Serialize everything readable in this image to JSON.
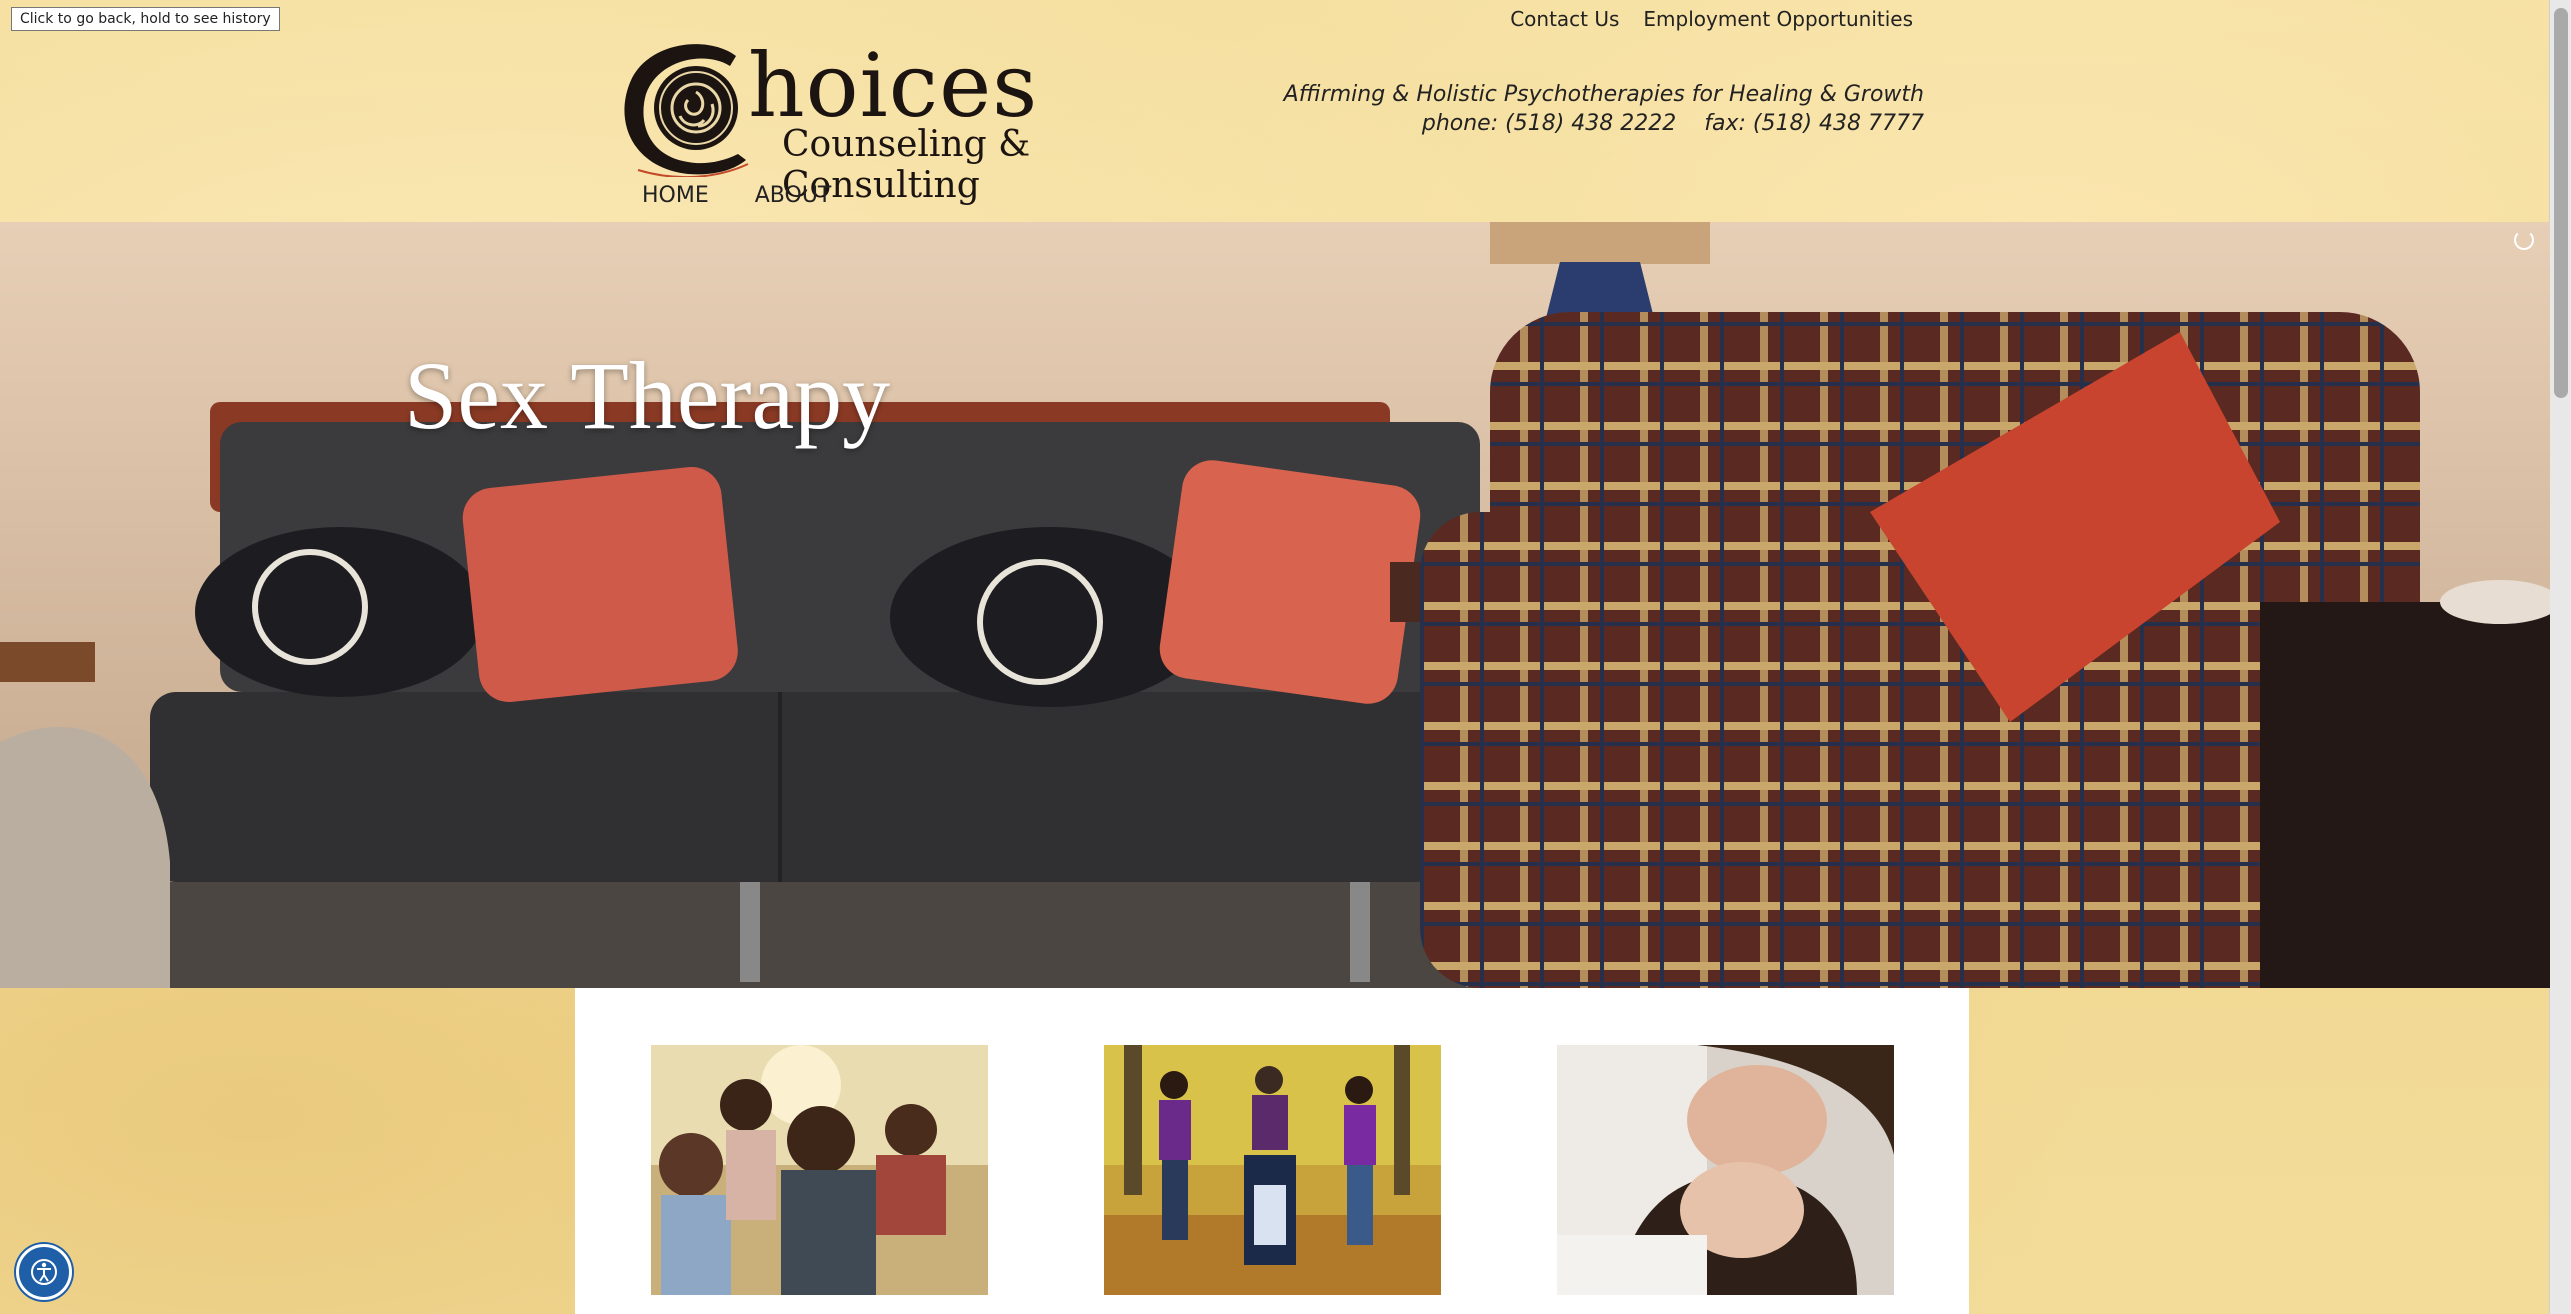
{
  "browser": {
    "back_tooltip": "Click to go back, hold to see history"
  },
  "header": {
    "top_links": [
      "Contact Us",
      "Employment Opportunities"
    ],
    "logo_title": "hoices",
    "logo_initial": "C",
    "logo_subtitle": "Counseling & Consulting",
    "tagline": "Affirming & Holistic Psychotherapies for Healing & Growth",
    "phone_line": "phone: (518) 438 2222    fax: (518) 438 7777",
    "nav": [
      "HOME",
      "ABOUT"
    ]
  },
  "hero": {
    "title": "Sex Therapy"
  },
  "cards": [
    {
      "image": "family-piggyback-photo"
    },
    {
      "image": "family-park-wheelchair-photo"
    },
    {
      "image": "couple-embrace-photo"
    }
  ],
  "colors": {
    "parchment": "#f3dc9f",
    "accessibility_button": "#1f5fa8"
  }
}
